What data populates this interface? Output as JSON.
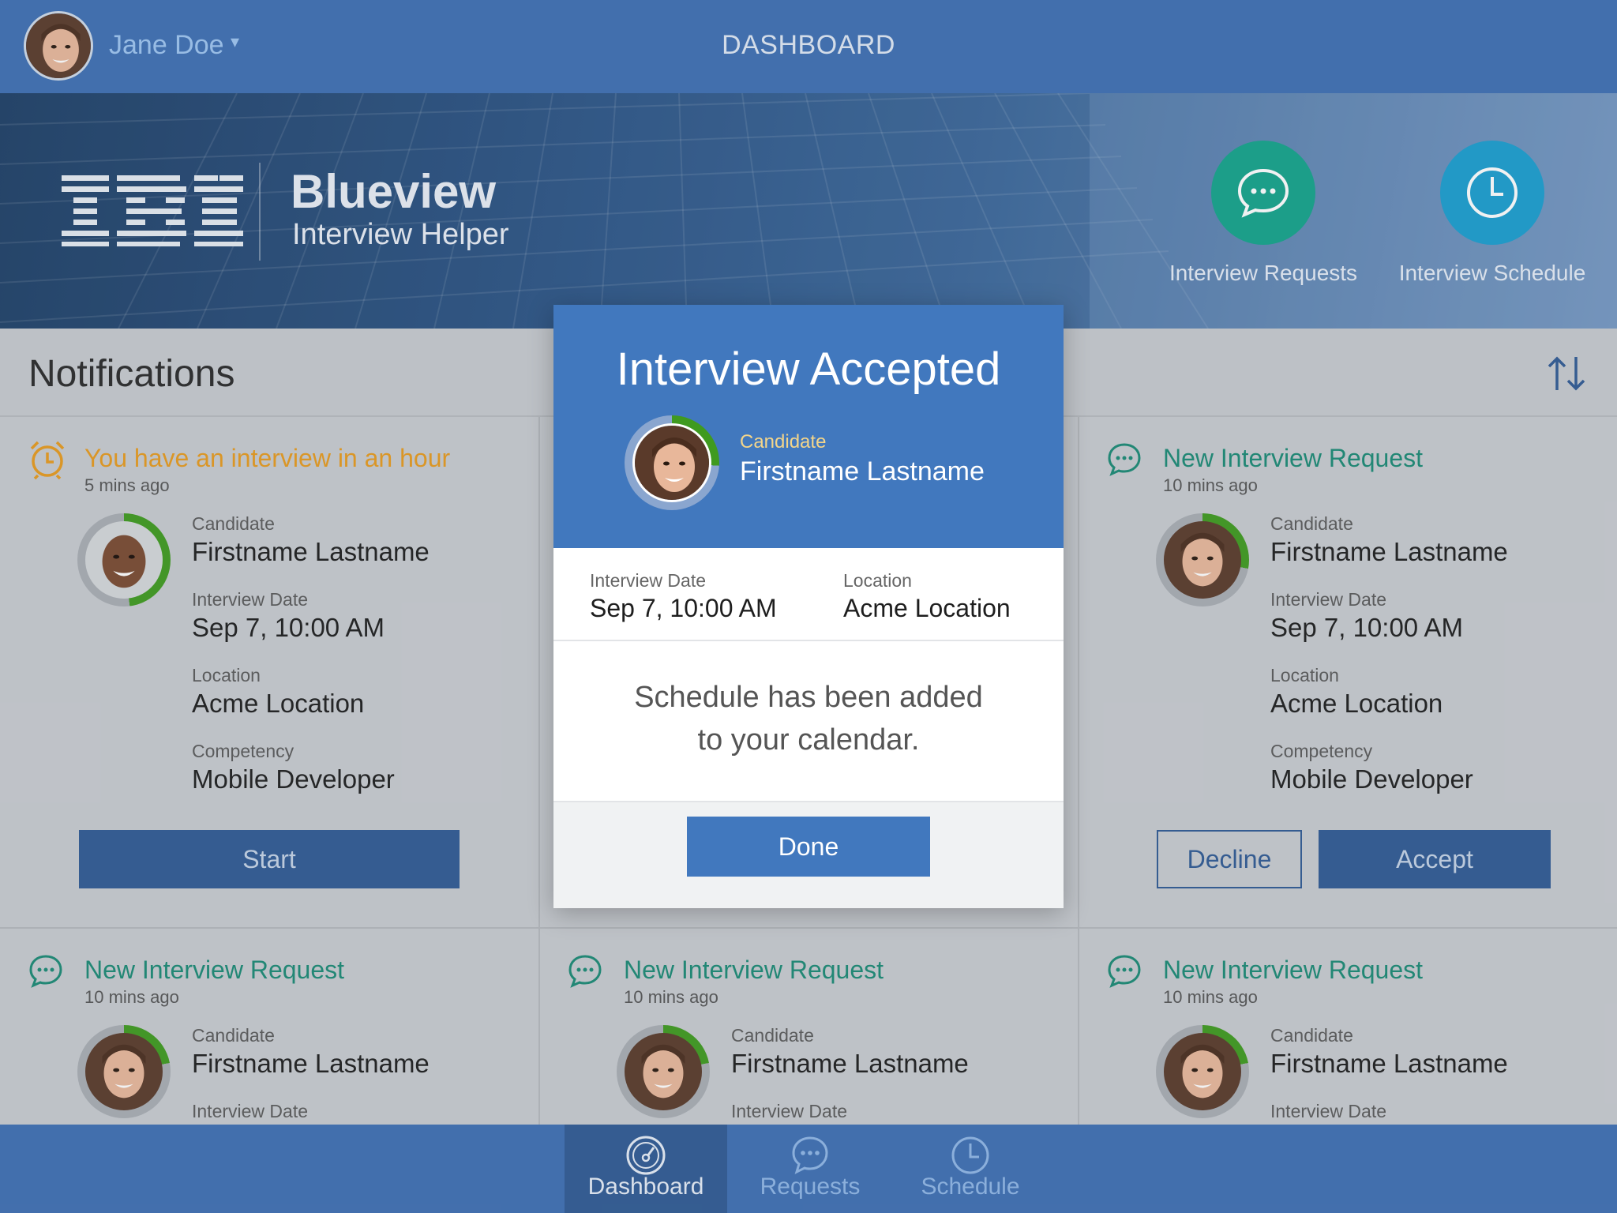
{
  "header": {
    "user_name": "Jane Doe",
    "title": "DASHBOARD"
  },
  "hero": {
    "company": "IBM",
    "brand_title": "Blueview",
    "brand_subtitle": "Interview Helper",
    "actions": [
      {
        "label": "Interview Requests",
        "icon": "chat-bubble-icon",
        "color": "#14a38b"
      },
      {
        "label": "Interview Schedule",
        "icon": "clock-icon",
        "color": "#1a9dcf"
      }
    ]
  },
  "notifications": {
    "title": "Notifications",
    "sort_icon": "sort-arrows-icon",
    "cards": [
      {
        "title": "You have an interview in an hour",
        "time": "5 mins ago",
        "icon": "alarm-clock-icon",
        "title_color": "#e79a1d",
        "candidate_label": "Candidate",
        "candidate": "Firstname Lastname",
        "date_label": "Interview Date",
        "date": "Sep 7,  10:00 AM",
        "location_label": "Location",
        "location": "Acme Location",
        "competency_label": "Competency",
        "competency": "Mobile Developer",
        "primary_button": "Start"
      },
      {
        "title": "New Interview Request",
        "time": "10 mins ago",
        "icon": "chat-bubble-icon",
        "title_color": "#1a8a74",
        "candidate_label": "Candidate",
        "candidate": "Firstname Lastname",
        "date_label": "Interview Date",
        "date": "Sep 7,  10:00 AM",
        "location_label": "Location",
        "location": "Acme Location",
        "competency_label": "Competency",
        "competency": "Mobile Developer",
        "secondary_button": "Decline",
        "primary_button": "Accept"
      },
      {
        "title": "New Interview Request",
        "time": "10 mins ago",
        "candidate_label": "Candidate",
        "candidate": "Firstname Lastname",
        "date_label": "Interview Date"
      },
      {
        "title": "New Interview Request",
        "time": "10 mins ago",
        "candidate_label": "Candidate",
        "candidate": "Firstname Lastname",
        "date_label": "Interview Date"
      },
      {
        "title": "New Interview Request",
        "time": "10 mins ago",
        "candidate_label": "Candidate",
        "candidate": "Firstname Lastname",
        "date_label": "Interview Date"
      }
    ]
  },
  "modal": {
    "title": "Interview Accepted",
    "candidate_label": "Candidate",
    "candidate": "Firstname Lastname",
    "date_label": "Interview Date",
    "date": "Sep 7,  10:00 AM",
    "location_label": "Location",
    "location": "Acme Location",
    "message_line1": "Schedule has been added",
    "message_line2": "to your calendar.",
    "done_button": "Done"
  },
  "tabbar": {
    "tabs": [
      {
        "label": "Dashboard",
        "icon": "speedometer-icon",
        "active": true
      },
      {
        "label": "Requests",
        "icon": "chat-bubble-icon",
        "active": false
      },
      {
        "label": "Schedule",
        "icon": "clock-icon",
        "active": false
      }
    ]
  }
}
